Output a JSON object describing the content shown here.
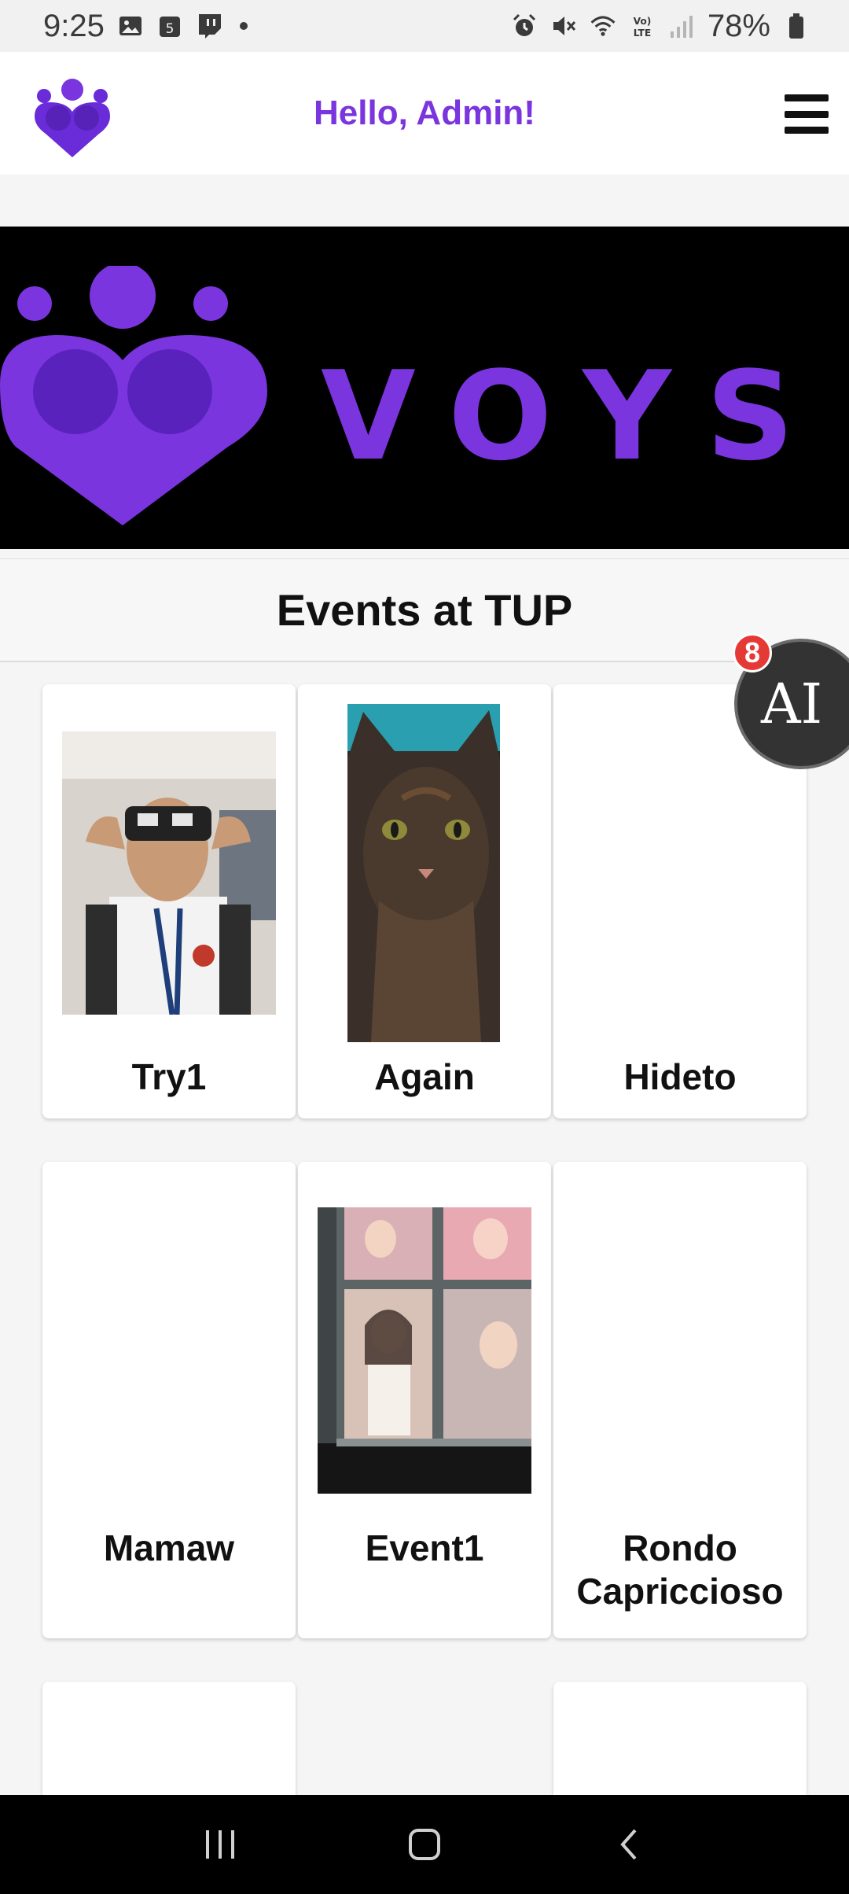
{
  "status_bar": {
    "time": "9:25",
    "battery": "78%",
    "left_icons": [
      "image-icon",
      "calendar-icon",
      "twitch-icon",
      "dot-icon"
    ],
    "right_icons": [
      "alarm-icon",
      "mute-icon",
      "wifi-icon",
      "volte-icon",
      "signal-icon",
      "battery-icon"
    ]
  },
  "header": {
    "greeting": "Hello, Admin!",
    "accent": "#7a35de"
  },
  "banner": {
    "brand": "VOYS"
  },
  "events": {
    "title": "Events at TUP",
    "items": [
      {
        "name": "Try1",
        "has_image": true
      },
      {
        "name": "Again",
        "has_image": true
      },
      {
        "name": "Hideto",
        "has_image": false
      },
      {
        "name": "Mamaw",
        "has_image": false
      },
      {
        "name": "Event1",
        "has_image": true
      },
      {
        "name": "Rondo Capriccioso",
        "has_image": false
      }
    ]
  },
  "ai_button": {
    "label": "AI",
    "badge": "8"
  },
  "nav": {
    "buttons": [
      "recents-icon",
      "home-icon",
      "back-icon"
    ]
  }
}
